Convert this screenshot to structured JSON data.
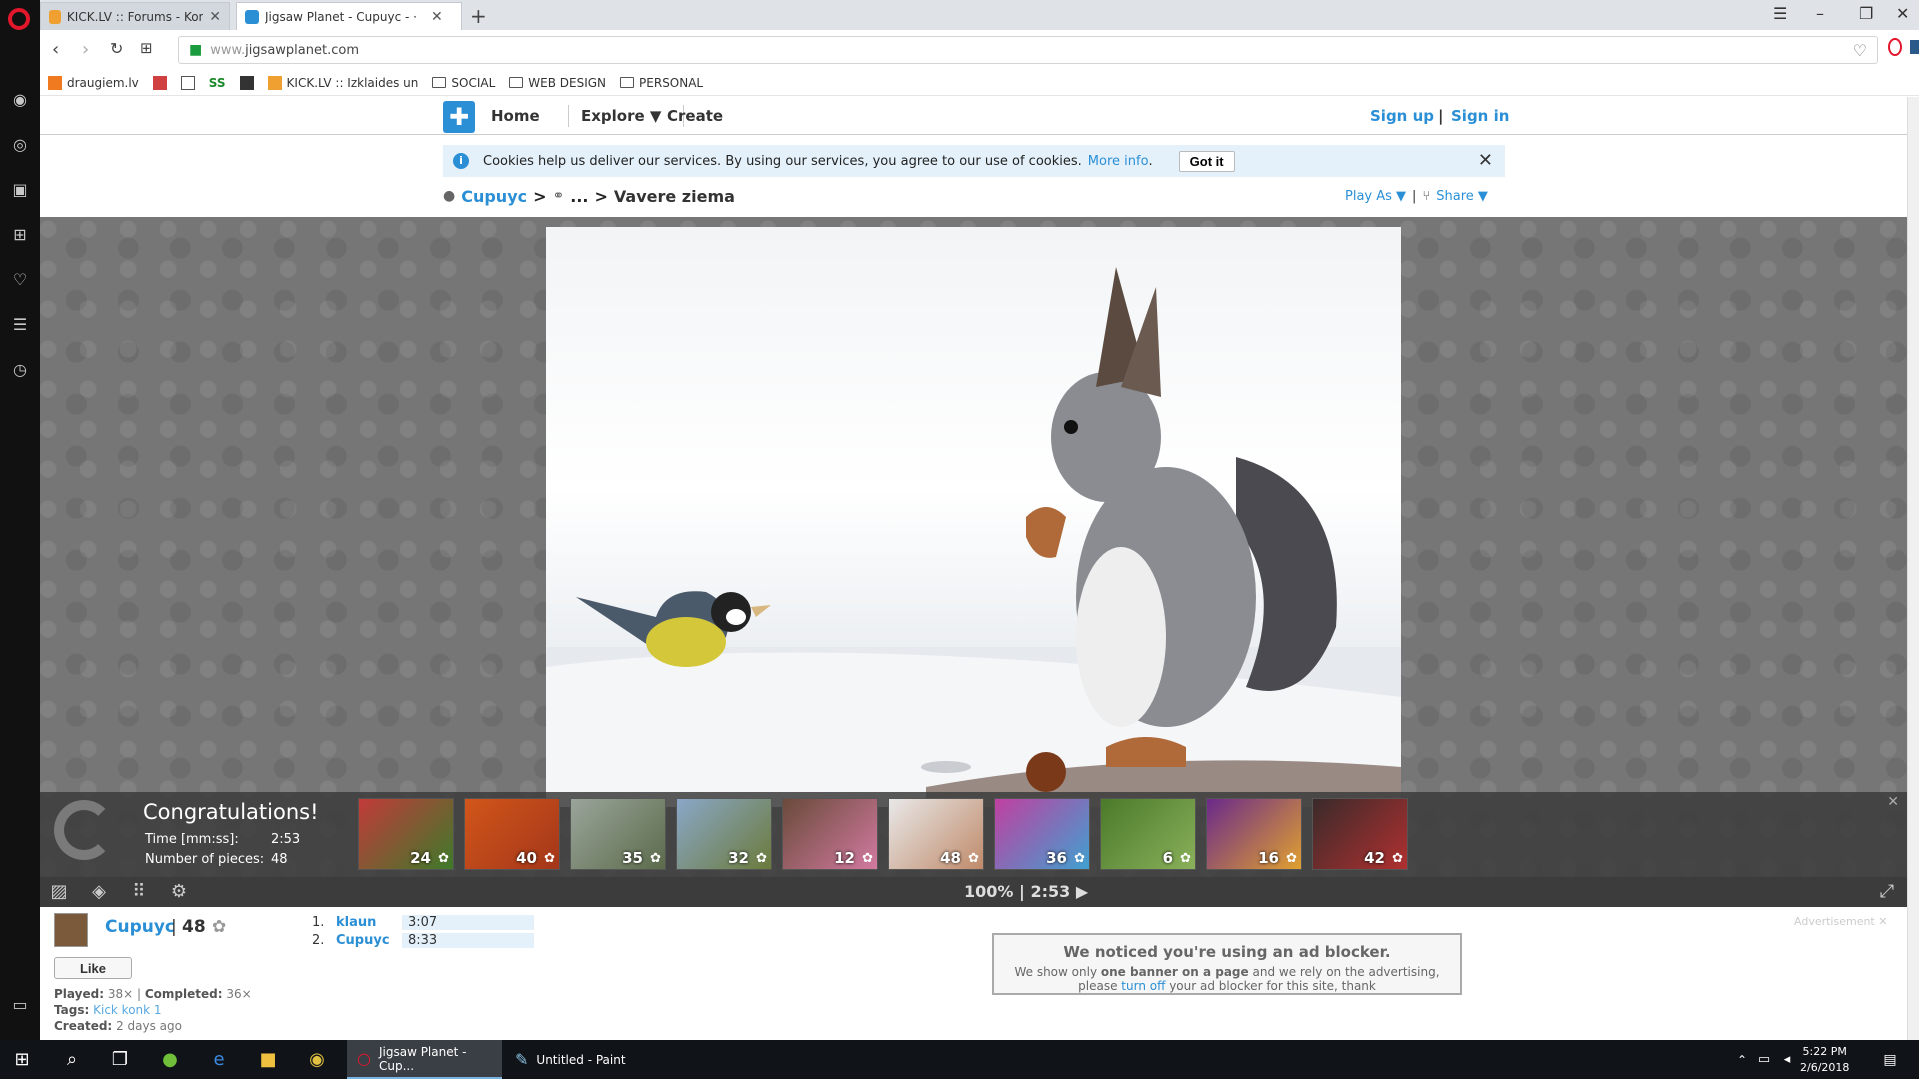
{
  "browser": {
    "tabs": [
      {
        "title": "KICK.LV :: Forums - Konkur",
        "active": false
      },
      {
        "title": "Jigsaw Planet - Cupuyc - ·",
        "active": true
      }
    ],
    "url_prefix": "www.",
    "url_domain": "jigsawplanet.com",
    "bookmarks": [
      {
        "label": "draugiem.lv",
        "type": "site"
      },
      {
        "label": "SS",
        "type": "site"
      },
      {
        "label": "KICK.LV :: Izklaides un",
        "type": "site"
      },
      {
        "label": "SOCIAL",
        "type": "folder"
      },
      {
        "label": "WEB DESIGN",
        "type": "folder"
      },
      {
        "label": "PERSONAL",
        "type": "folder"
      }
    ]
  },
  "site": {
    "nav": {
      "home": "Home",
      "explore": "Explore ▼",
      "create": "Create"
    },
    "auth": {
      "signup": "Sign up",
      "separator": "|",
      "signin": "Sign in"
    },
    "cookie": {
      "text": "Cookies help us deliver our services. By using our services, you agree to our use of cookies.",
      "more": "More info",
      "period": ".",
      "button": "Got it"
    },
    "breadcrumb": {
      "user": "Cupuyc",
      "sep1": ">",
      "ellipsis": "...",
      "sep2": ">",
      "title": "Vavere ziema"
    },
    "play_as": "Play As ▼",
    "divider": "|",
    "share": "Share ▼"
  },
  "congrats": {
    "title": "Congratulations!",
    "time_label": "Time [mm:ss]:",
    "time_value": "2:53",
    "pieces_label": "Number of pieces:",
    "pieces_value": "48",
    "thumbnails": [
      {
        "count": "24",
        "color1": "#c23a3a",
        "color2": "#3d7a2a"
      },
      {
        "count": "40",
        "color1": "#d2561a",
        "color2": "#a3361a"
      },
      {
        "count": "35",
        "color1": "#9aa59a",
        "color2": "#5b6b4b"
      },
      {
        "count": "32",
        "color1": "#8aa7c8",
        "color2": "#6b7b3b"
      },
      {
        "count": "12",
        "color1": "#6a4a3a",
        "color2": "#d27aa0"
      },
      {
        "count": "48",
        "color1": "#e8e8e8",
        "color2": "#c08a6a"
      },
      {
        "count": "36",
        "color1": "#c040a0",
        "color2": "#40a0d0"
      },
      {
        "count": "6",
        "color1": "#4a7a2a",
        "color2": "#8ab05a"
      },
      {
        "count": "16",
        "color1": "#6a2a8a",
        "color2": "#e0a030"
      },
      {
        "count": "42",
        "color1": "#3a2a2a",
        "color2": "#b03030"
      }
    ]
  },
  "toolbar": {
    "zoom": "100%",
    "sep": "|",
    "time": "2:53",
    "play": "▶"
  },
  "owner": {
    "name": "Cupuyc",
    "sep": "|",
    "pieces": "48"
  },
  "like": "Like",
  "meta": {
    "played_label": "Played:",
    "played": "38×",
    "meta_sep": "|",
    "completed_label": "Completed:",
    "completed": "36×",
    "tags_label": "Tags:",
    "tags": "Kick konk 1",
    "created_label": "Created:",
    "created": "2 days ago"
  },
  "leaderboard": [
    {
      "rank": "1.",
      "name": "klaun",
      "time": "3:07"
    },
    {
      "rank": "2.",
      "name": "Cupuyc",
      "time": "8:33"
    }
  ],
  "adblock": {
    "title": "We noticed you're using an ad blocker.",
    "body_pre": "We show only",
    "body_bold": "one banner on a page",
    "body_mid": "and we rely on the advertising, please",
    "body_link": "turn off",
    "body_post": "your ad blocker for this site, thank",
    "ad_label": "Advertisement"
  },
  "taskbar": {
    "apps": [
      {
        "label": "Jigsaw Planet - Cup...",
        "active": true
      },
      {
        "label": "Untitled - Paint",
        "active": false
      }
    ],
    "time": "5:22 PM",
    "date": "2/6/2018"
  },
  "colors": {
    "accent": "#2b8fd6",
    "opera_red": "#e3162b"
  }
}
